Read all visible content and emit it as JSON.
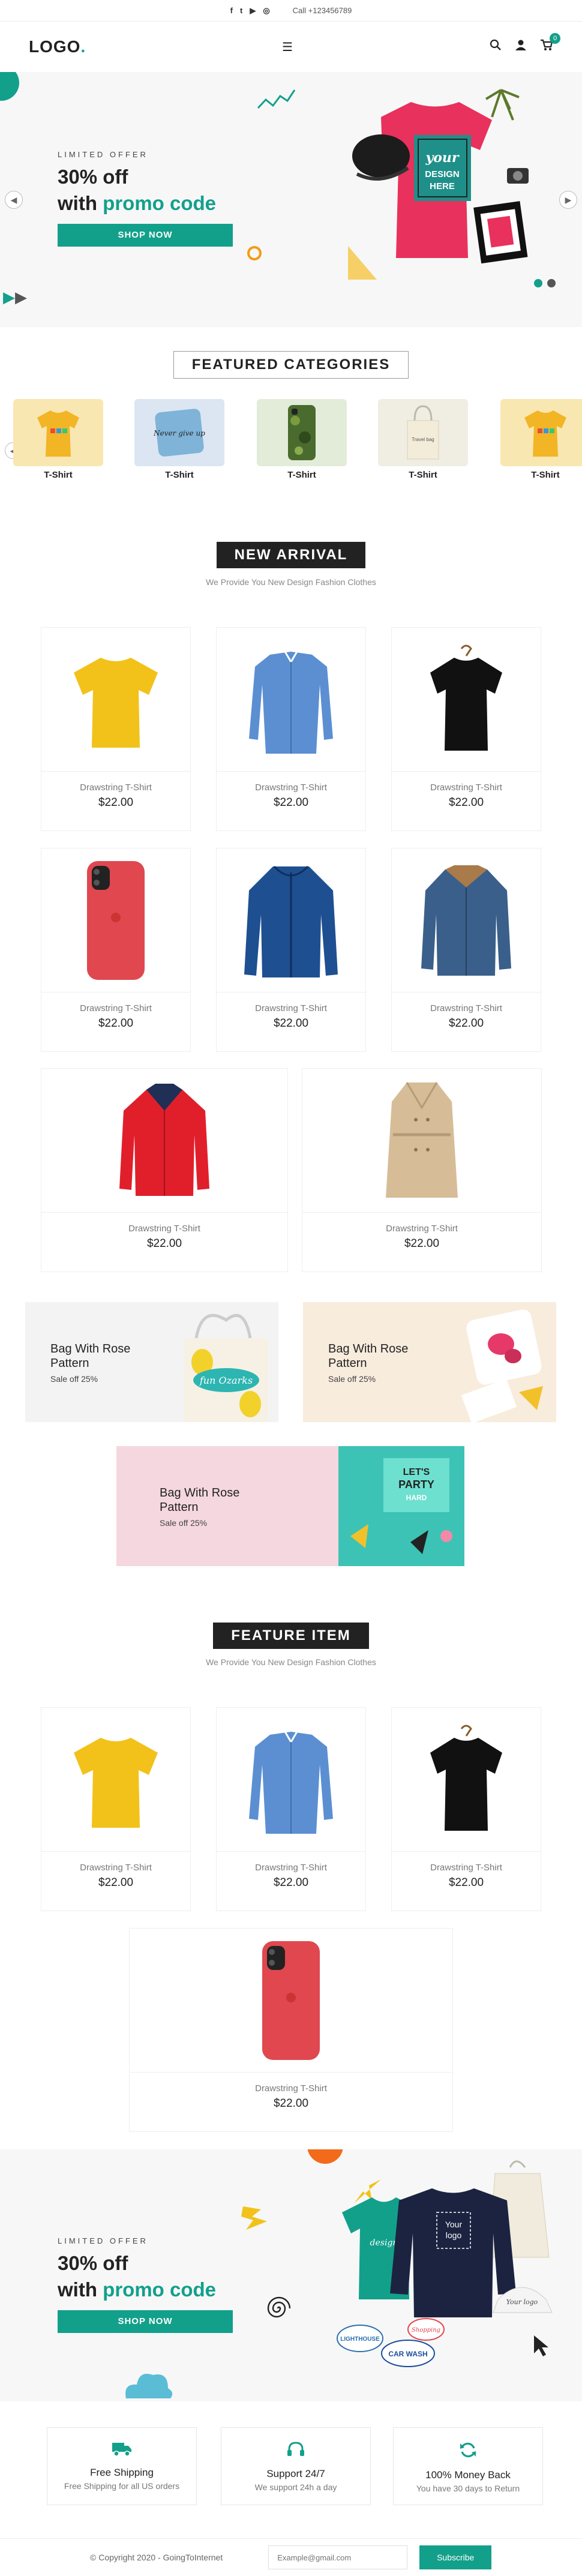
{
  "topbar": {
    "social": [
      "f",
      "t",
      "▶",
      "◎"
    ],
    "call": "Call +123456789"
  },
  "header": {
    "logo": "LOGO",
    "logo_dot": ".",
    "cart_count": "0"
  },
  "hero1": {
    "kicker": "LIMITED OFFER",
    "line1": "30% off",
    "line2_pre": "with ",
    "line2_accent": "promo code",
    "button": "SHOP NOW",
    "tee_text": "your DESIGN HERE",
    "frame_text": "your design"
  },
  "featured_categories": {
    "title": "FEATURED CATEGORIES",
    "items": [
      {
        "label": "T-Shirt"
      },
      {
        "label": "T-Shirt"
      },
      {
        "label": "T-Shirt"
      },
      {
        "label": "T-Shirt"
      },
      {
        "label": "T-Shirt"
      }
    ],
    "pillow_text": "Never give up",
    "bag_text": "Travel bag"
  },
  "new_arrival": {
    "title": "NEW ARRIVAL",
    "subtitle": "We Provide You New Design Fashion Clothes",
    "products": [
      {
        "name": "Drawstring T-Shirt",
        "price": "$22.00"
      },
      {
        "name": "Drawstring T-Shirt",
        "price": "$22.00"
      },
      {
        "name": "Drawstring T-Shirt",
        "price": "$22.00"
      },
      {
        "name": "Drawstring T-Shirt",
        "price": "$22.00"
      },
      {
        "name": "Drawstring T-Shirt",
        "price": "$22.00"
      },
      {
        "name": "Drawstring T-Shirt",
        "price": "$22.00"
      },
      {
        "name": "Drawstring T-Shirt",
        "price": "$22.00"
      },
      {
        "name": "Drawstring T-Shirt",
        "price": "$22.00"
      }
    ]
  },
  "promos": [
    {
      "title_l1": "Bag With Rose",
      "title_l2": "Pattern",
      "sub": "Sale off 25%"
    },
    {
      "title_l1": "Bag With Rose",
      "title_l2": "Pattern",
      "sub": "Sale off 25%"
    },
    {
      "title_l1": "Bag With Rose",
      "title_l2": "Pattern",
      "sub": "Sale off 25%"
    }
  ],
  "promo_art": {
    "bag_text": "fun Ozarks",
    "party_l1": "LET'S",
    "party_l2": "PARTY",
    "party_l3": "HARD"
  },
  "feature_item": {
    "title": "FEATURE ITEM",
    "subtitle": "We Provide You New Design Fashion Clothes",
    "products": [
      {
        "name": "Drawstring T-Shirt",
        "price": "$22.00"
      },
      {
        "name": "Drawstring T-Shirt",
        "price": "$22.00"
      },
      {
        "name": "Drawstring T-Shirt",
        "price": "$22.00"
      },
      {
        "name": "Drawstring T-Shirt",
        "price": "$22.00"
      }
    ]
  },
  "hero2": {
    "kicker": "LIMITED OFFER",
    "line1": "30% off",
    "line2_pre": "with ",
    "line2_accent": "promo code",
    "button": "SHOP NOW",
    "sweater_text": "Your logo",
    "cap_text": "Your logo",
    "tee_text": "design",
    "sticker1": "LIGHTHOUSE",
    "sticker2": "CAR WASH",
    "sticker3": "Shopping"
  },
  "features": [
    {
      "title": "Free Shipping",
      "sub": "Free Shipping for all US orders",
      "icon": "truck-icon"
    },
    {
      "title": "Support 24/7",
      "sub": "We support 24h a day",
      "icon": "headset-icon"
    },
    {
      "title": "100% Money Back",
      "sub": "You have 30 days to Return",
      "icon": "refresh-icon"
    }
  ],
  "footer": {
    "copyright": "© Copyright 2020 - GoingToInternet",
    "email_placeholder": "Example@gmail.com",
    "subscribe": "Subscribe"
  },
  "colors": {
    "accent": "#12a08b",
    "dark": "#222222",
    "orange": "#f39c12"
  }
}
